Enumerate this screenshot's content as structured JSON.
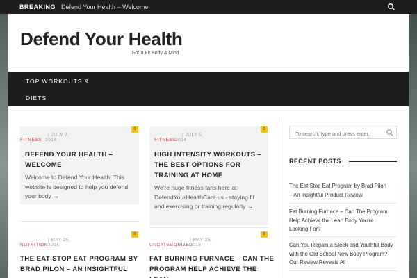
{
  "topbar": {
    "breaking_label": "BREAKING",
    "ticker_text": "Defend Your Health – Welcome"
  },
  "header": {
    "site_title": "Defend Your Health",
    "tagline": "For a Fit Body & Mind"
  },
  "nav": {
    "items": [
      {
        "label": "TOP WORKOUTS &"
      },
      {
        "label": "DIETS"
      }
    ]
  },
  "posts": [
    {
      "category": "FITNESS",
      "date_line1": "JULY 7,",
      "date_line2": "2014",
      "comments": "0",
      "title_line1": "DEFEND YOUR HEALTH –",
      "title_line2": "WELCOME",
      "excerpt_lines": [
        "Welcome to Defend Your Health! This",
        "website is designed to help you defend",
        "your body"
      ],
      "more_arrow": "→"
    },
    {
      "category": "FITNESS",
      "date_line1": "JULY 5,",
      "date_line2": "2014",
      "comments": "0",
      "title_line1": "HIGH INTENSITY WORKOUTS –",
      "title_line2": "THE BEST OPTIONS FOR",
      "title_line3": "TRAINING AT HOME",
      "excerpt_lines": [
        "We're huge fitness fans here at",
        "DefendYourHealthCare.us - staying fit",
        "and exercising or training regularly"
      ],
      "more_arrow": "→"
    },
    {
      "category": "NUTRITION",
      "date_line1": "MAY 25,",
      "date_line2": "2015",
      "comments": "0",
      "title_line1": "THE EAT STOP EAT PROGRAM BY",
      "title_line2": "BRAD PILON – AN INSIGHTFUL"
    },
    {
      "category": "UNCATEGORIZED",
      "date_line1": "MAY 25,",
      "date_line2": "2015",
      "comments": "0",
      "title_line1": "FAT BURNING FURNACE – CAN THE",
      "title_line2": "PROGRAM HELP ACHIEVE THE LEAN"
    }
  ],
  "sidebar": {
    "search_placeholder": "To search, type and press enter.",
    "recent_posts_title": "RECENT POSTS",
    "recent_posts": [
      {
        "lines": [
          "The Eat Stop Eat Program by Brad Pilon",
          "– An Insightful Product Review"
        ]
      },
      {
        "lines": [
          "Fat Burning Furnace – Can The Program",
          "Help Achieve the Lean Body You're",
          "Looking For?"
        ]
      },
      {
        "lines": [
          "Can You Regain a Sleek and Youthful Body",
          "with the Old School New Body Program?",
          "Our Review Reveals All"
        ]
      }
    ]
  },
  "colors": {
    "accent_red": "#d23b3b",
    "badge_yellow": "#f5c518",
    "dark_bar": "#1d1d1d"
  }
}
